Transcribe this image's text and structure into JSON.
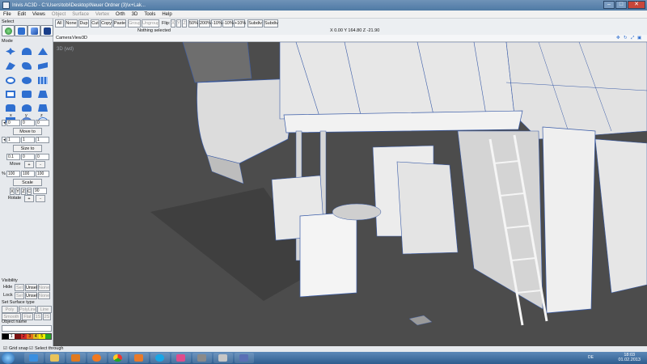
{
  "window": {
    "title": "Inivis AC3D - C:\\Users\\tobi\\Desktop\\Neuer Ordner (3)\\x+Lak...",
    "controls": [
      "–",
      "□",
      "✕"
    ]
  },
  "menubar": {
    "items": [
      {
        "label": "File",
        "enabled": true
      },
      {
        "label": "Edit",
        "enabled": true
      },
      {
        "label": "Views",
        "enabled": true
      },
      {
        "label": "Object",
        "enabled": false
      },
      {
        "label": "Surface",
        "enabled": false
      },
      {
        "label": "Vertex",
        "enabled": false
      },
      {
        "label": "Orth",
        "enabled": true
      },
      {
        "label": "3D",
        "enabled": true
      },
      {
        "label": "Tools",
        "enabled": true
      },
      {
        "label": "Help",
        "enabled": true
      }
    ]
  },
  "left_panel": {
    "select_label": "Select",
    "mode_label": "Mode",
    "axis_labels": [
      "x",
      "y",
      "z"
    ],
    "move_row": [
      "0",
      "0",
      "0"
    ],
    "move_to": "Move to",
    "size_row": [
      "1",
      "1",
      "1"
    ],
    "size_to": "Size to",
    "step_value": "0.1",
    "step_row": [
      "0",
      "0"
    ],
    "move_label": "Move",
    "plus": "+",
    "minus": "-",
    "scale_row": [
      "100",
      "100",
      "100"
    ],
    "pct": "%",
    "scale": "Scale",
    "axes_toggle": [
      "X",
      "Y",
      "Z"
    ],
    "c_label": "C",
    "angle_value": "90",
    "rotate": "Rotate",
    "visibility": "Visibility",
    "hide": "Hide",
    "lock": "Lock",
    "sel": "Sel",
    "unsel": "Unsel",
    "none": "None",
    "set_surface_type": "Set Surface type",
    "surface_row1": [
      "Poly",
      "PolyLine",
      "Line"
    ],
    "surface_row2": [
      "Smooth",
      "Flat",
      "1S",
      "2S"
    ],
    "object_name": "Object name",
    "color_swatches": [
      "1",
      "2",
      "3",
      "4",
      "5"
    ]
  },
  "toolbar": {
    "all": "All",
    "none": "None",
    "dup": "Dup",
    "cut": "Cut",
    "copy": "Copy",
    "paste": "Paste",
    "group": "Group",
    "ungroup": "Ungroup",
    "flip": "Flip:",
    "flip_axes": [
      "X",
      "Y",
      "Z"
    ],
    "zoom_50": "50%",
    "zoom_200": "200%",
    "pct_minus": "-10%",
    "pct_minus2": "-10%",
    "pct_plus": "+10%",
    "subdiv_plus": "Subdiv +",
    "subdiv_minus": "Subdiv -",
    "status": "Nothing selected",
    "coords": "X 0.00 Y 164.80 Z -21.90"
  },
  "view": {
    "camera": "Camera",
    "view": "View",
    "mode3d": "3D",
    "viewport_label": "3D (wd)"
  },
  "bottom": {
    "grid_snap": "Grid snap",
    "select_through": "Select through"
  },
  "taskbar": {
    "lang": "DE",
    "time": "18:03",
    "date": "01.02.2013"
  },
  "colors": {
    "accent": "#2f6fd0",
    "viewport_bg": "#4c4c4c",
    "mesh_fill": "#f0f0f0",
    "edge": "#3a5ca8"
  }
}
